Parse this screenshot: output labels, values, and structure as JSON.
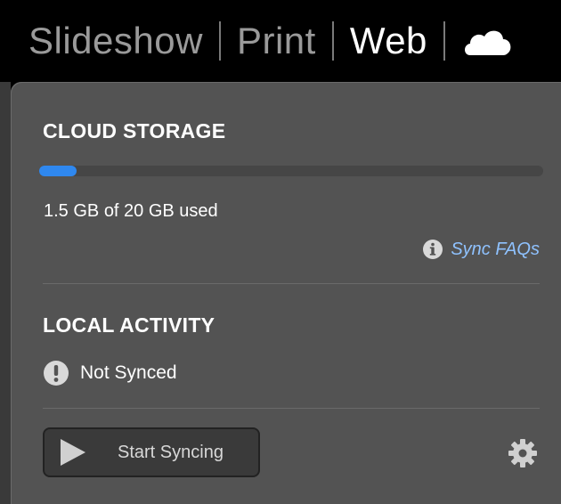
{
  "module_bar": {
    "items": [
      "Slideshow",
      "Print",
      "Web"
    ],
    "active": "Web",
    "cloud_icon": "cloud-icon"
  },
  "cloud_storage": {
    "title": "CLOUD STORAGE",
    "used_fraction": 0.075,
    "usage_text": "1.5 GB of 20 GB used",
    "faq_link": "Sync FAQs",
    "faq_icon": "info-icon",
    "accent_color": "#2f88ef"
  },
  "local_activity": {
    "title": "LOCAL ACTIVITY",
    "status_text": "Not Synced",
    "status_icon": "warning-icon"
  },
  "actions": {
    "start_button_label": "Start Syncing",
    "start_icon": "play-icon",
    "settings_icon": "gear-icon"
  }
}
